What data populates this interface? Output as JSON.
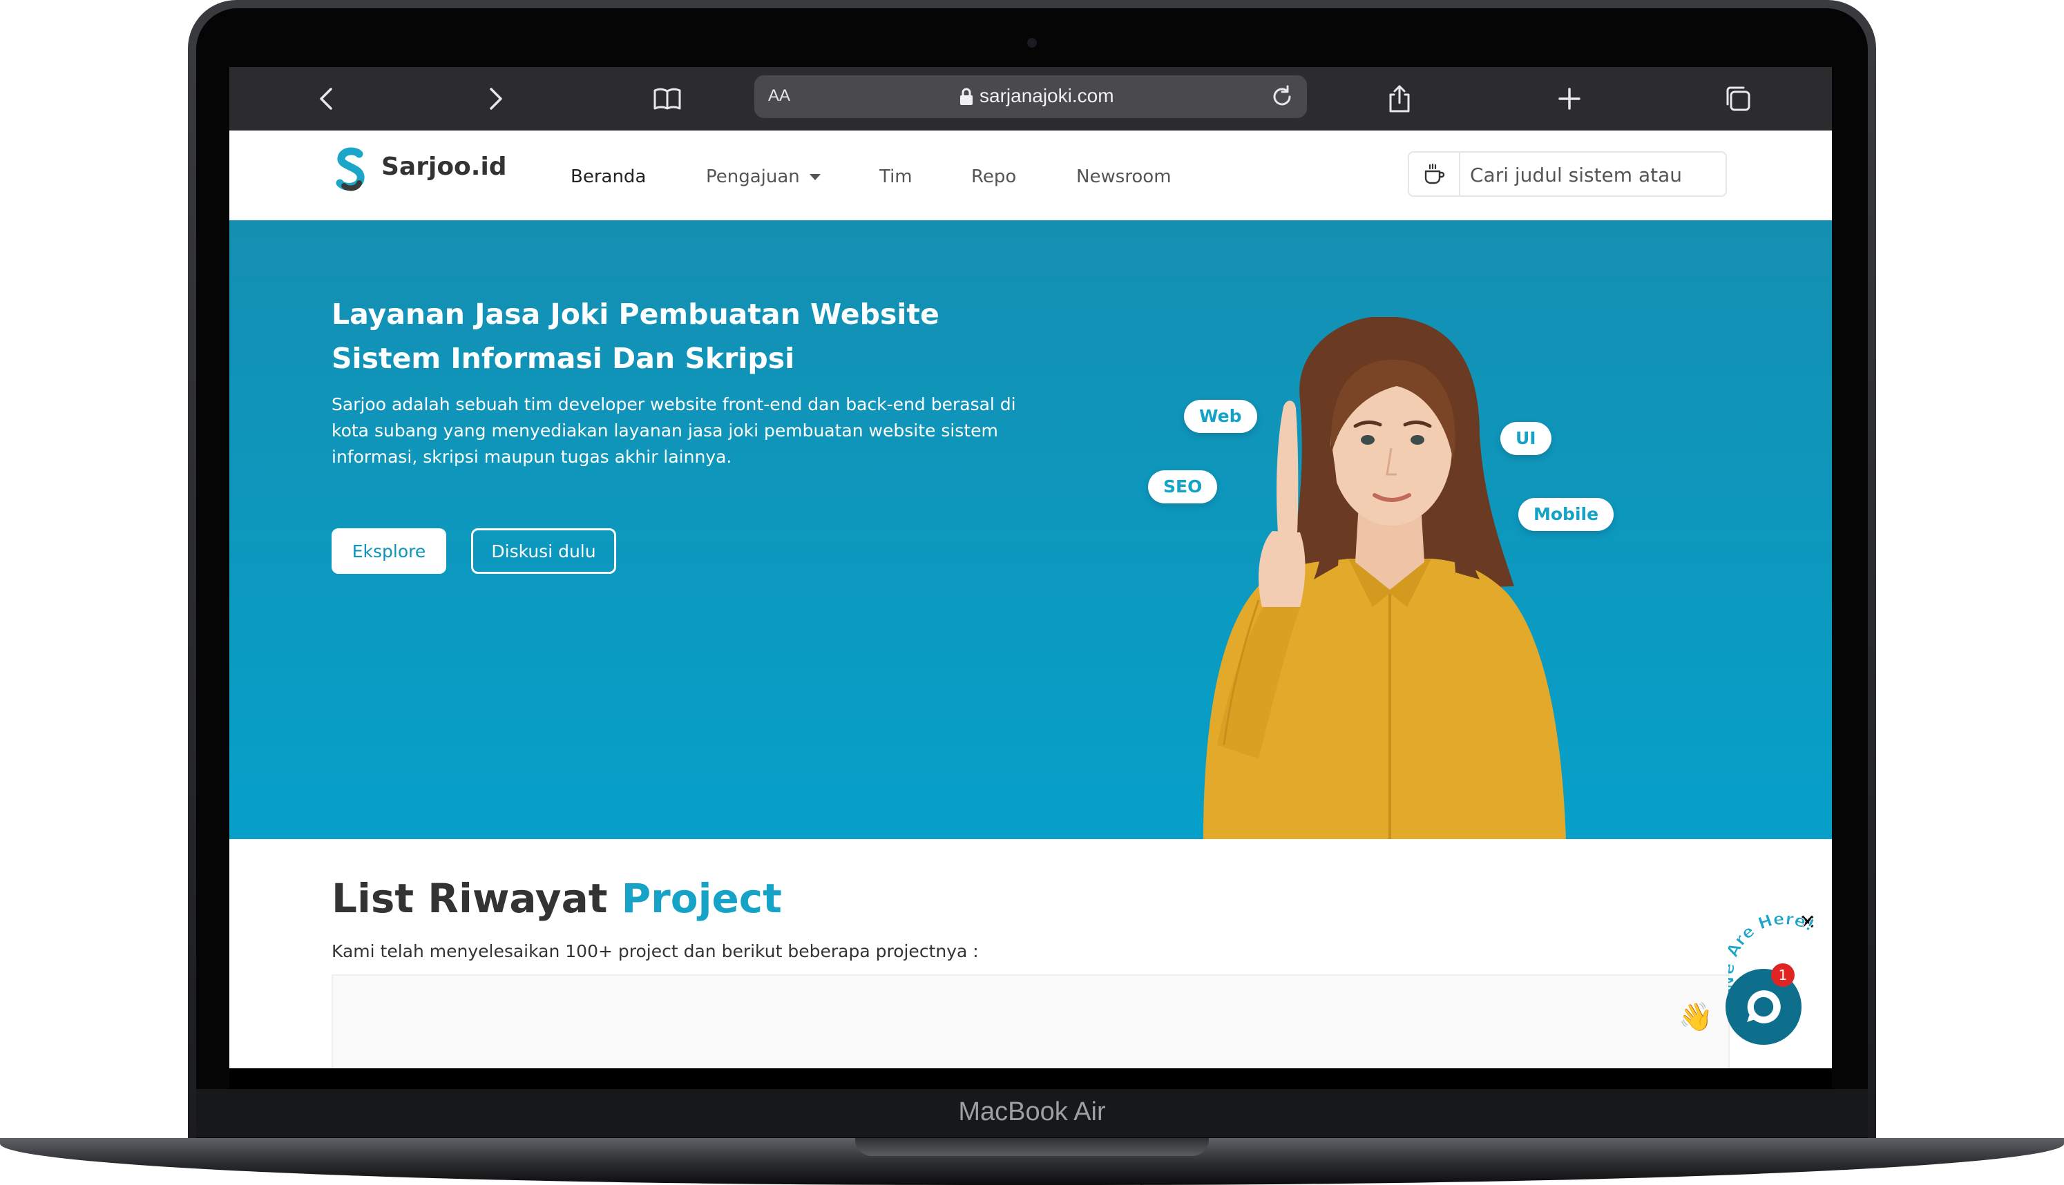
{
  "device": {
    "label": "MacBook Air"
  },
  "browser": {
    "aa_label": "AA",
    "address": "sarjanajoki.com"
  },
  "site": {
    "logo_text": "Sarjoo.id",
    "nav": [
      {
        "label": "Beranda"
      },
      {
        "label": "Pengajuan"
      },
      {
        "label": "Tim"
      },
      {
        "label": "Repo"
      },
      {
        "label": "Newsroom"
      }
    ],
    "search_placeholder": "Cari judul sistem atau"
  },
  "hero": {
    "title": "Layanan Jasa Joki Pembuatan Website Sistem Informasi Dan Skripsi",
    "description": "Sarjoo adalah sebuah tim developer website front-end dan back-end berasal di kota subang yang menyediakan layanan jasa joki pembuatan website sistem informasi, skripsi maupun tugas akhir lainnya.",
    "primary_button": "Eksplore",
    "secondary_button": "Diskusi dulu",
    "tags": [
      "Web",
      "UI",
      "SEO",
      "Mobile"
    ]
  },
  "projects": {
    "title_part1": "List Riwayat ",
    "title_part2": "Project",
    "subtitle": "Kami telah menyelesaikan 100+ project dan berikut beberapa projectnya :"
  },
  "chat": {
    "close_label": "×",
    "banner_text": "We Are Here!",
    "badge_count": "1"
  },
  "colors": {
    "accent": "#16a3c7",
    "hero_top": "#148fb2",
    "hero_bottom": "#06a0c9",
    "shirt": "#e3a92a",
    "badge": "#e02424"
  }
}
